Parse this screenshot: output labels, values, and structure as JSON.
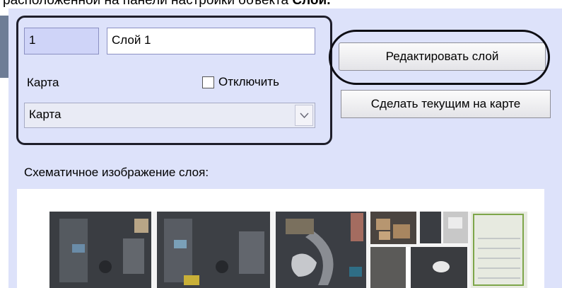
{
  "caption": {
    "prefix": "расположенной на панели настройки объекта ",
    "object_name": "Слой."
  },
  "layer": {
    "id_value": "1",
    "name_value": "Слой 1"
  },
  "map": {
    "label": "Карта",
    "selected": "Карта"
  },
  "disable_checkbox": {
    "label": "Отключить",
    "checked": false
  },
  "buttons": {
    "edit_layer": "Редактировать слой",
    "make_current": "Сделать текущим на карте"
  },
  "schematic": {
    "label": "Схематичное изображение слоя:"
  },
  "icons": {
    "select_arrow": "chevron-down-icon",
    "floor_plan": "floor-plan-image"
  },
  "colors": {
    "panel_bg": "#dde2fa",
    "highlight_ring": "#0e0e14"
  }
}
